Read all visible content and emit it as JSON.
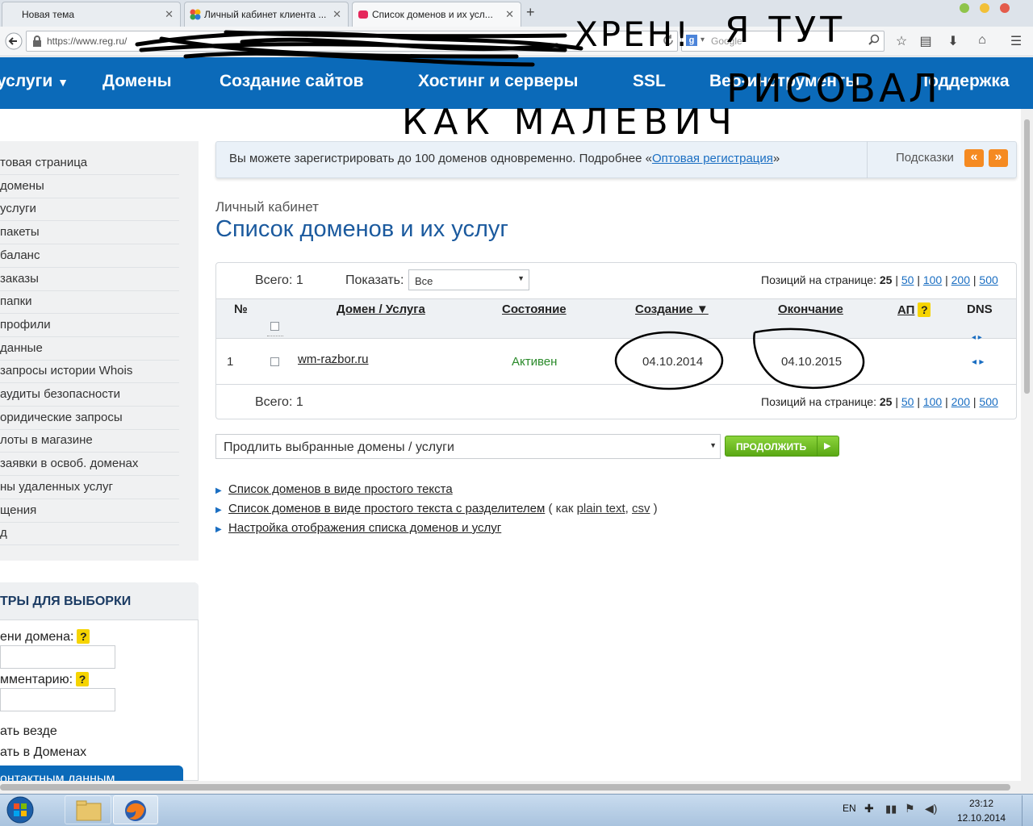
{
  "browser": {
    "tabs": [
      {
        "title": "Новая тема"
      },
      {
        "title": "Личный кабинет клиента ..."
      },
      {
        "title": "Список доменов и их усл..."
      }
    ],
    "url_visible": "https://www.reg.ru/",
    "search_placeholder": "Google",
    "scribble_text": [
      "ХРЕН!",
      "Я ТУТ",
      "РИСОВАЛ",
      "КАК МАЛЕВИЧ"
    ]
  },
  "topmenu": {
    "items": [
      "услуги",
      "Домены",
      "Создание сайтов",
      "Хостинг и серверы",
      "SSL",
      "Веб-инструменты",
      "Поддержка"
    ]
  },
  "sidebar": {
    "items": [
      "товая страница",
      "домены",
      "услуги",
      "пакеты",
      "баланс",
      "заказы",
      "папки",
      "профили",
      "данные",
      "запросы истории Whois",
      "аудиты безопасности",
      "оридические запросы",
      "лоты в магазине",
      "заявки в освоб. доменах",
      "ны удаленных услуг",
      "щения",
      "д"
    ]
  },
  "filters": {
    "title": "ТРЫ ДЛЯ ВЫБОРКИ",
    "by_name_label": "ени домена:",
    "by_comment_label": "мментарию:",
    "help": "?",
    "search_all": "ать везде",
    "search_domains": "ать в Доменах",
    "contacts_button": "онтактным данным"
  },
  "notice": {
    "text_before": "Вы можете зарегистрировать до 100 доменов одновременно. Подробнее «",
    "link": "Оптовая регистрация",
    "text_after": "»",
    "hints_label": "Подсказки",
    "prev": "«",
    "next": "»"
  },
  "page": {
    "breadcrumb": "Личный кабинет",
    "title": "Список доменов и их услуг"
  },
  "table": {
    "total_label": "Всего: 1",
    "show_label": "Показать:",
    "show_value": "Все",
    "per_page_label": "Позиций на странице:",
    "per_page_current": "25",
    "per_page_options": [
      "50",
      "100",
      "200",
      "500"
    ],
    "headers": {
      "num": "№",
      "domain": "Домен / Услуга",
      "status": "Состояние",
      "created": "Создание ▼",
      "expires": "Окончание",
      "ap": "АП",
      "dns": "DNS"
    },
    "rows": [
      {
        "num": "1",
        "domain": "wm-razbor.ru",
        "status": "Активен",
        "created": "04.10.2014",
        "expires": "04.10.2015"
      }
    ]
  },
  "bulk_action": {
    "select_value": "Продлить выбранные домены / услуги",
    "continue_label": "ПРОДОЛЖИТЬ"
  },
  "links": [
    {
      "text": "Список доменов в виде простого текста"
    },
    {
      "text": "Список доменов в виде простого текста с разделителем",
      "suffix_before": " ( как ",
      "sub1": "plain text",
      "sep": ", ",
      "sub2": "csv",
      "suffix_after": " )"
    },
    {
      "text": "Настройка отображения списка доменов и услуг"
    }
  ],
  "taskbar": {
    "lang": "EN",
    "time": "23:12",
    "date": "12.10.2014"
  },
  "colors": {
    "brand_blue": "#0b6ab9",
    "status_green": "#2a8a2a",
    "link_blue": "#1a6ec2",
    "orange": "#f58a21",
    "green_button": "#6fbf1f"
  }
}
